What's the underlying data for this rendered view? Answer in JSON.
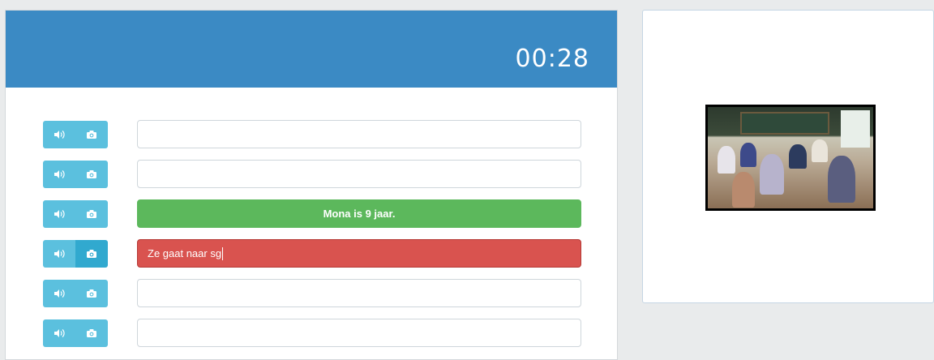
{
  "timer": "00:28",
  "rows": [
    {
      "status": "empty",
      "text": ""
    },
    {
      "status": "empty",
      "text": ""
    },
    {
      "status": "correct",
      "text": "Mona is 9 jaar."
    },
    {
      "status": "wrong",
      "text": "Ze gaat naar sg"
    },
    {
      "status": "empty",
      "text": ""
    },
    {
      "status": "empty",
      "text": ""
    }
  ],
  "icons": {
    "audio": "speaker-icon",
    "camera": "camera-icon"
  },
  "colors": {
    "header": "#3b8ac4",
    "button": "#5bc0de",
    "correct": "#5cb85c",
    "wrong": "#d9534f"
  },
  "image": {
    "subject": "classroom-photo"
  }
}
